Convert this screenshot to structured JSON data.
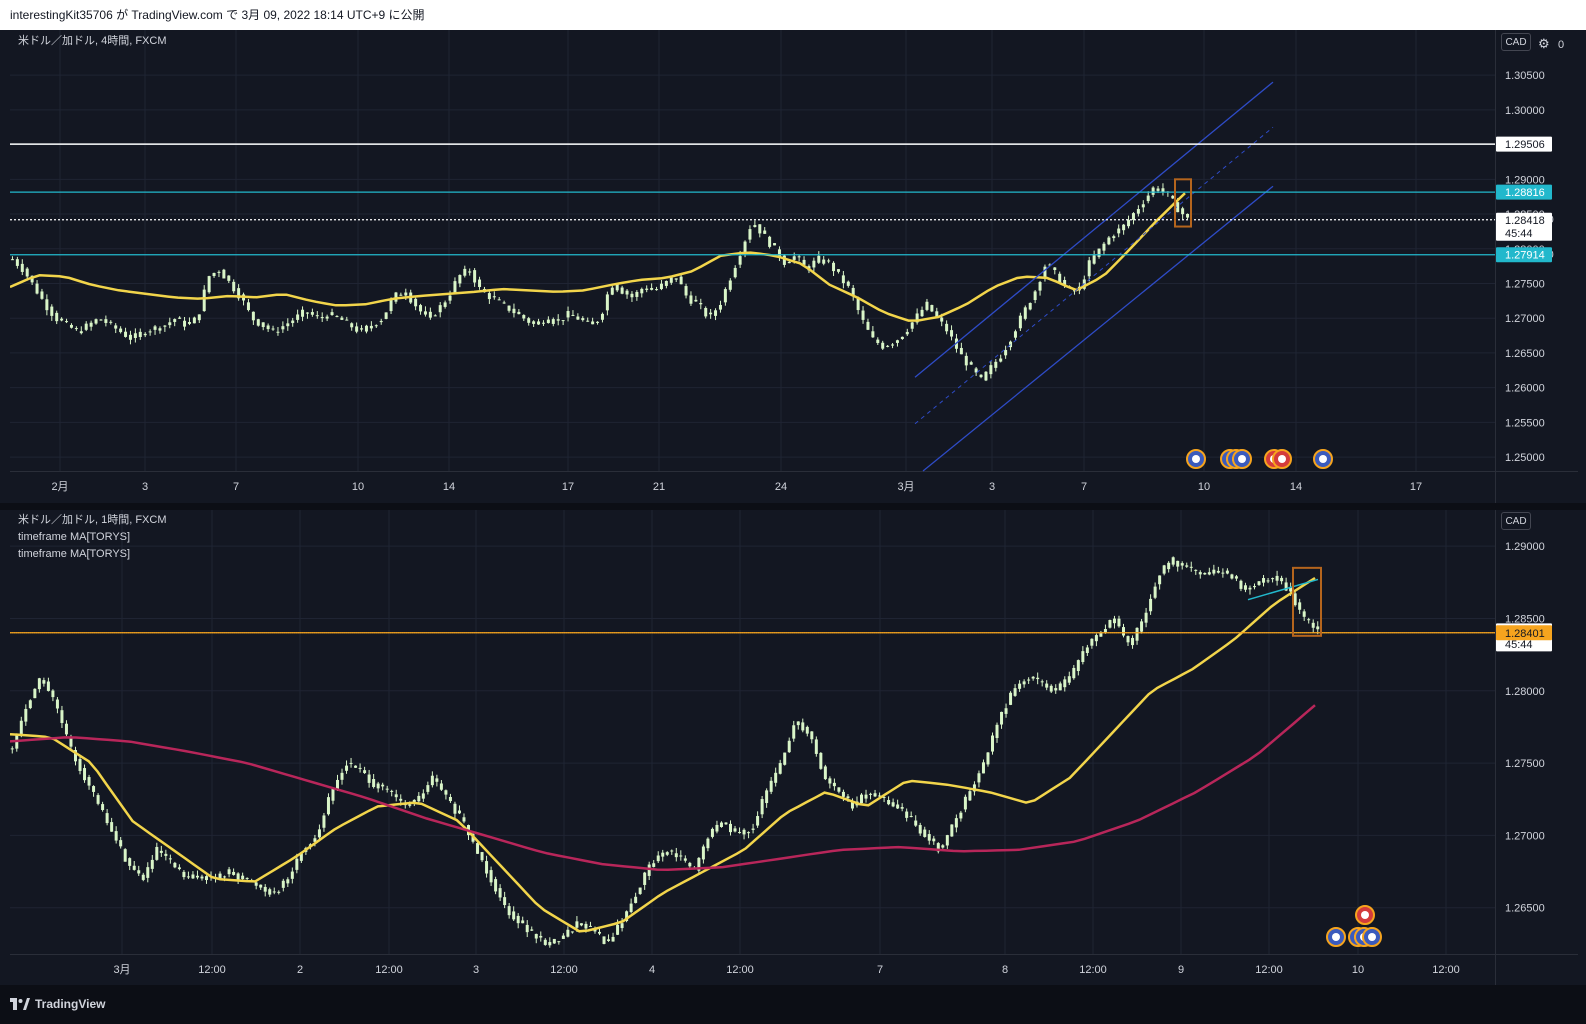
{
  "header": {
    "title": "interestingKit35706 が TradingView.com で 3月 09, 2022 18:14 UTC+9 に公開"
  },
  "footer": {
    "brand": "TradingView"
  },
  "colors": {
    "bg": "#131722",
    "grid": "#1f2433",
    "axis_text": "#d1d4dc",
    "up": "#d9f5c8",
    "down": "#d9f5c8",
    "ma_yellow": "#f2d54b",
    "ma_red": "#b8265a",
    "channel": "#2e4bc6",
    "white_line": "#ffffff",
    "cyan_line": "#22b8cc",
    "orange": "#f6a41e",
    "rect": "#b5651d"
  },
  "chart_data": [
    {
      "type": "candlestick",
      "symbol_label": "米ドル／加ドル, 4時間, FXCM",
      "currency_badge": "CAD",
      "y_range": [
        1.248,
        1.3115
      ],
      "y_ticks": [
        "1.25000",
        "1.25500",
        "1.26000",
        "1.26500",
        "1.27000",
        "1.27500",
        "1.28000",
        "1.28500",
        "1.29000",
        "1.29500",
        "1.30000",
        "1.30500"
      ],
      "x_ticks": [
        "2月",
        "3",
        "7",
        "10",
        "14",
        "17",
        "21",
        "24",
        "3月",
        "3",
        "7",
        "10",
        "14",
        "17"
      ],
      "close_path": [
        1.2785,
        1.277,
        1.2745,
        1.272,
        1.27,
        1.269,
        1.268,
        1.269,
        1.27,
        1.269,
        1.268,
        1.267,
        1.268,
        1.2685,
        1.269,
        1.27,
        1.269,
        1.27,
        1.276,
        1.277,
        1.275,
        1.273,
        1.27,
        1.269,
        1.268,
        1.269,
        1.27,
        1.271,
        1.27,
        1.2705,
        1.27,
        1.269,
        1.268,
        1.269,
        1.27,
        1.273,
        1.274,
        1.272,
        1.27,
        1.271,
        1.273,
        1.276,
        1.277,
        1.274,
        1.273,
        1.272,
        1.271,
        1.27,
        1.269,
        1.27,
        1.2695,
        1.2705,
        1.27,
        1.269,
        1.27,
        1.275,
        1.274,
        1.273,
        1.2745,
        1.274,
        1.275,
        1.276,
        1.273,
        1.272,
        1.27,
        1.272,
        1.276,
        1.28,
        1.284,
        1.282,
        1.28,
        1.278,
        1.279,
        1.277,
        1.2785,
        1.278,
        1.276,
        1.274,
        1.27,
        1.267,
        1.266,
        1.2665,
        1.268,
        1.27,
        1.272,
        1.27,
        1.268,
        1.265,
        1.263,
        1.261,
        1.263,
        1.265,
        1.268,
        1.271,
        1.274,
        1.278,
        1.276,
        1.274,
        1.274,
        1.278,
        1.28,
        1.282,
        1.283,
        1.285,
        1.287,
        1.289,
        1.288,
        1.286,
        1.2842
      ],
      "ma": {
        "color": "yellow",
        "values": [
          1.2745,
          1.2762,
          1.276,
          1.2748,
          1.274,
          1.2735,
          1.273,
          1.2728,
          1.2732,
          1.273,
          1.2735,
          1.2725,
          1.2718,
          1.272,
          1.2728,
          1.2732,
          1.2735,
          1.2738,
          1.2742,
          1.274,
          1.2738,
          1.274,
          1.2748,
          1.2755,
          1.2758,
          1.2768,
          1.279,
          1.2795,
          1.279,
          1.2778,
          1.2748,
          1.273,
          1.2708,
          1.2695,
          1.2702,
          1.272,
          1.2745,
          1.276,
          1.2758,
          1.274,
          1.276,
          1.28,
          1.2842,
          1.288
        ]
      },
      "horizontal_levels": [
        {
          "price": "1.29506",
          "color": "white"
        },
        {
          "price": "1.28816",
          "color": "cyan"
        },
        {
          "price": "1.28418",
          "sub": "45:44",
          "color": "dotted"
        },
        {
          "price": "1.27914",
          "color": "cyan"
        }
      ],
      "axis_clipped_labels": [
        "1.",
        "0",
        "1.28500",
        "1.28000"
      ],
      "event_icons": [
        "us-flag-icon",
        "us-flag-icon",
        "us-flag-icon",
        "us-flag-icon",
        "ca-flag-icon",
        "ca-flag-icon",
        "us-flag-icon"
      ]
    },
    {
      "type": "candlestick",
      "symbol_label": "米ドル／加ドル, 1時間, FXCM",
      "indicators": [
        "timeframe MA[TORYS]",
        "timeframe MA[TORYS]"
      ],
      "currency_badge": "CAD",
      "y_range": [
        1.2618,
        1.2925
      ],
      "y_ticks": [
        "1.26500",
        "1.27000",
        "1.27500",
        "1.28000",
        "1.28500",
        "1.29000"
      ],
      "x_ticks": [
        "3月",
        "12:00",
        "2",
        "12:00",
        "3",
        "12:00",
        "4",
        "12:00",
        "7",
        "8",
        "12:00",
        "9",
        "12:00",
        "10",
        "12:00"
      ],
      "close_path": [
        1.276,
        1.279,
        1.281,
        1.279,
        1.276,
        1.274,
        1.272,
        1.27,
        1.268,
        1.267,
        1.269,
        1.268,
        1.267,
        1.2672,
        1.267,
        1.2675,
        1.267,
        1.2665,
        1.266,
        1.267,
        1.269,
        1.27,
        1.273,
        1.275,
        1.2745,
        1.2735,
        1.273,
        1.272,
        1.2725,
        1.274,
        1.2725,
        1.271,
        1.269,
        1.267,
        1.265,
        1.264,
        1.263,
        1.2625,
        1.263,
        1.264,
        1.2635,
        1.2625,
        1.264,
        1.266,
        1.268,
        1.269,
        1.2685,
        1.2675,
        1.27,
        1.271,
        1.27,
        1.2705,
        1.273,
        1.275,
        1.278,
        1.277,
        1.274,
        1.273,
        1.272,
        1.273,
        1.2725,
        1.272,
        1.271,
        1.27,
        1.269,
        1.271,
        1.273,
        1.275,
        1.278,
        1.28,
        1.281,
        1.2805,
        1.28,
        1.281,
        1.283,
        1.284,
        1.285,
        1.283,
        1.285,
        1.288,
        1.289,
        1.2885,
        1.288,
        1.2882,
        1.288,
        1.287,
        1.2875,
        1.288,
        1.287,
        1.285,
        1.2842
      ],
      "ma_fast": {
        "color": "yellow",
        "values": [
          1.277,
          1.2768,
          1.275,
          1.271,
          1.269,
          1.267,
          1.2668,
          1.2685,
          1.2705,
          1.272,
          1.2723,
          1.271,
          1.268,
          1.265,
          1.2633,
          1.264,
          1.266,
          1.2675,
          1.269,
          1.2715,
          1.273,
          1.272,
          1.2738,
          1.2735,
          1.273,
          1.2722,
          1.274,
          1.277,
          1.28,
          1.2815,
          1.2835,
          1.286,
          1.2878
        ]
      },
      "ma_slow": {
        "color": "red",
        "values": [
          1.2765,
          1.2768,
          1.2765,
          1.2758,
          1.275,
          1.2738,
          1.2726,
          1.2712,
          1.27,
          1.2688,
          1.268,
          1.2676,
          1.2678,
          1.2684,
          1.269,
          1.2692,
          1.2689,
          1.269,
          1.2696,
          1.271,
          1.273,
          1.2755,
          1.279
        ]
      },
      "horizontal_levels": [
        {
          "price": "1.28418",
          "sub": "45:44",
          "color": "white"
        },
        {
          "price": "1.28401",
          "color": "orange"
        }
      ],
      "axis_clipped_labels": [],
      "event_icons": [
        "ca-flag-icon",
        "us-flag-icon",
        "us-flag-icon",
        "us-flag-icon",
        "us-flag-icon"
      ]
    }
  ]
}
